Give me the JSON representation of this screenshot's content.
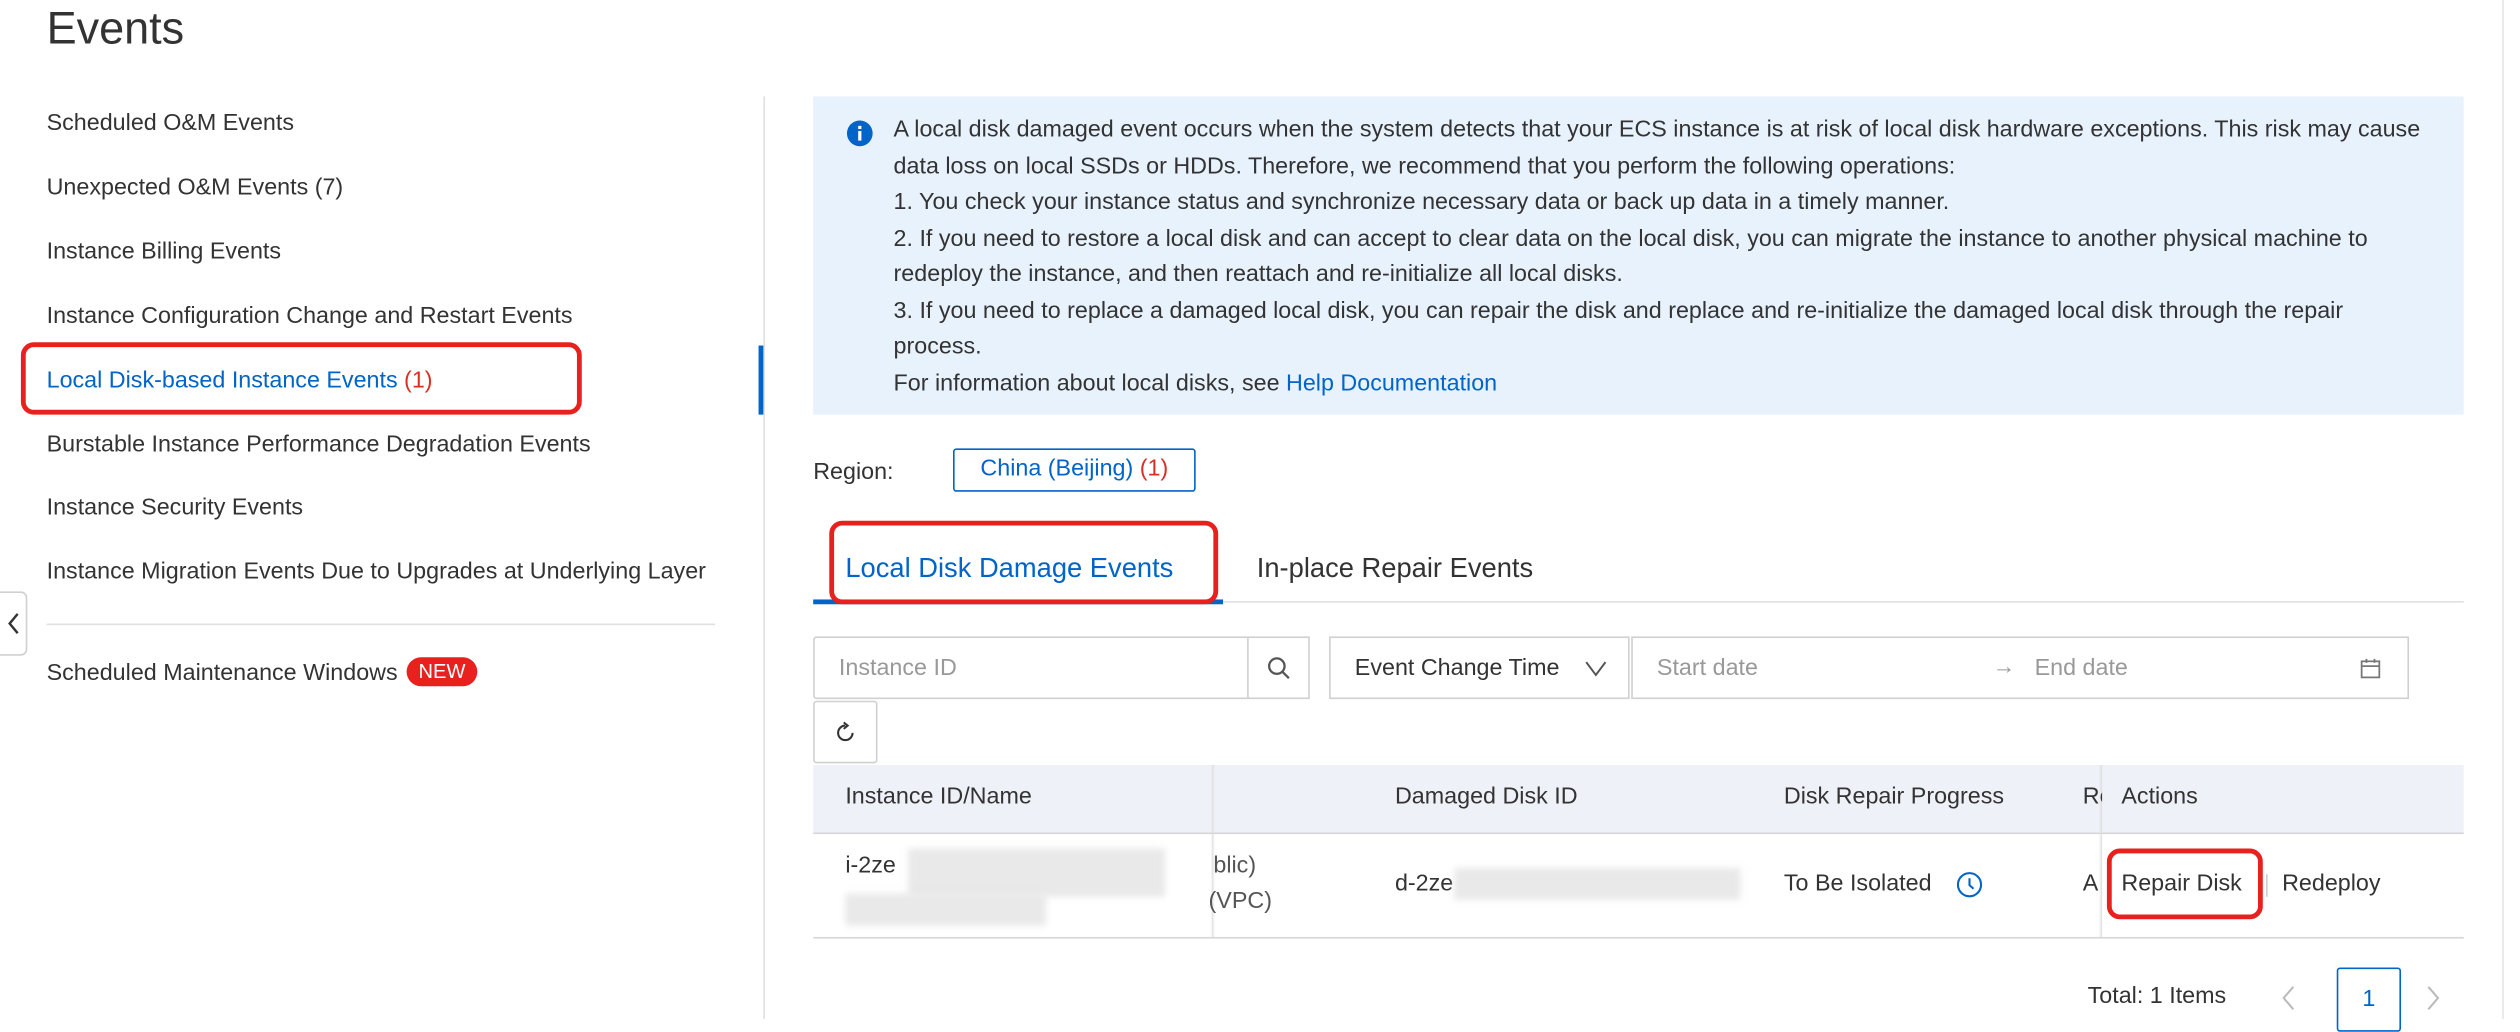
{
  "page_title": "Events",
  "sidebar": {
    "items": [
      {
        "label": "Scheduled O&M Events",
        "count": ""
      },
      {
        "label": "Unexpected O&M Events",
        "count": "(7)"
      },
      {
        "label": "Instance Billing Events",
        "count": ""
      },
      {
        "label": "Instance Configuration Change and Restart Events",
        "count": ""
      },
      {
        "label": "Local Disk-based Instance Events",
        "count": "(1)",
        "active": true
      },
      {
        "label": "Burstable Instance Performance Degradation Events",
        "count": ""
      },
      {
        "label": "Instance Security Events",
        "count": ""
      },
      {
        "label": "Instance Migration Events Due to Upgrades at Underlying Layer",
        "count": ""
      }
    ],
    "maintenance": {
      "label": "Scheduled Maintenance Windows",
      "badge": "NEW"
    }
  },
  "info": {
    "icon": "info-icon",
    "lines": [
      "A local disk damaged event occurs when the system detects that your ECS instance is at risk of local disk hardware exceptions. This risk may cause data loss on local SSDs or HDDs. Therefore, we recommend that you perform the following operations:",
      "1. You check your instance status and synchronize necessary data or back up data in a timely manner.",
      "2. If you need to restore a local disk and can accept to clear data on the local disk, you can migrate the instance to another physical machine to redeploy the instance, and then reattach and re-initialize all local disks.",
      "3. If you need to replace a damaged local disk, you can repair the disk and replace and re-initialize the damaged local disk through the repair process.",
      "For information about local disks, see "
    ],
    "link": "Help Documentation"
  },
  "region": {
    "label": "Region:",
    "value": "China (Beijing)",
    "count": "(1)"
  },
  "tabs": [
    {
      "label": "Local Disk Damage Events",
      "active": true
    },
    {
      "label": "In-place Repair Events"
    }
  ],
  "filters": {
    "instance_placeholder": "Instance ID",
    "time_select": "Event Change Time",
    "start_placeholder": "Start date",
    "end_placeholder": "End date"
  },
  "table": {
    "columns": [
      "Instance ID/Name",
      "Damaged Disk ID",
      "Disk Repair Progress",
      "Re",
      "Actions"
    ],
    "rows": [
      {
        "instance_id": "i-2ze",
        "network_1": "blic)",
        "network_2": "(VPC)",
        "disk_id": "d-2ze",
        "progress": "To Be Isolated",
        "truncated": "A",
        "actions": [
          "Repair Disk",
          "Redeploy"
        ]
      }
    ]
  },
  "pagination": {
    "total": "Total: 1 Items",
    "page": "1"
  },
  "colors": {
    "accent": "#0064c8",
    "danger": "#e8201e",
    "info_bg": "#e8f2fd"
  }
}
